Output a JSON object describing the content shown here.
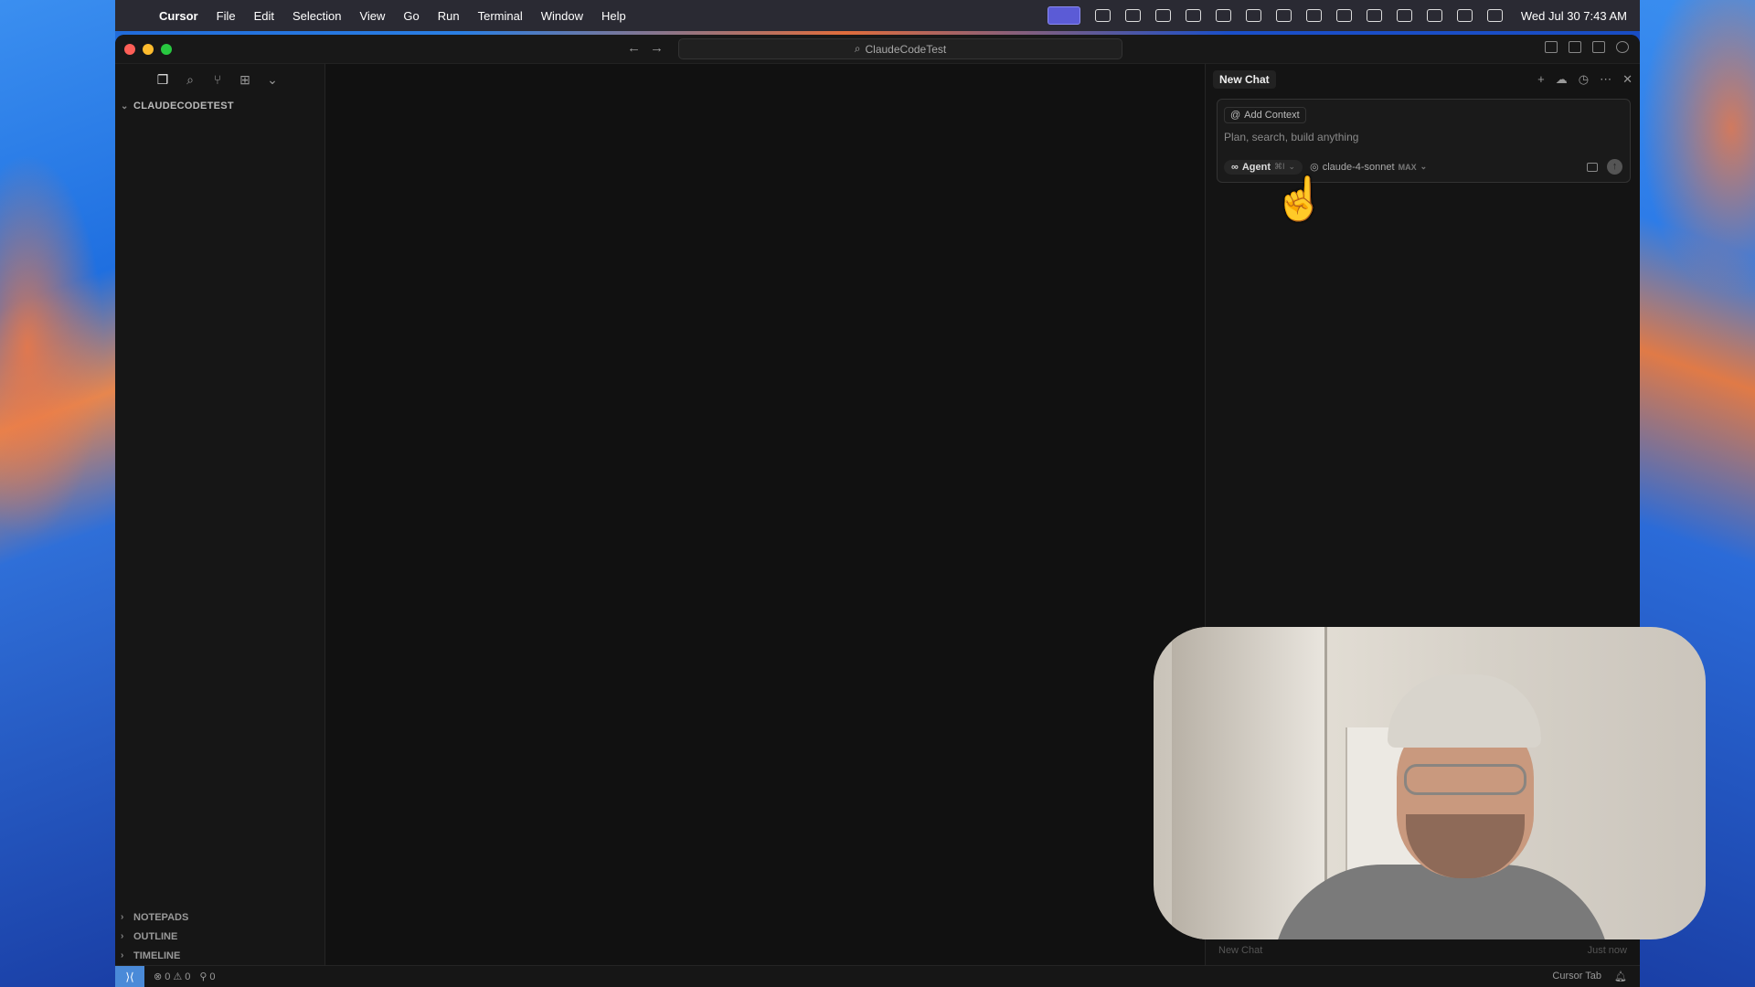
{
  "menubar": {
    "app_name": "Cursor",
    "items": [
      "File",
      "Edit",
      "Selection",
      "View",
      "Go",
      "Run",
      "Terminal",
      "Window",
      "Help"
    ],
    "datetime": "Wed Jul 30  7:43 AM"
  },
  "window": {
    "title": "ClaudeCodeTest"
  },
  "sidebar": {
    "folder": "CLAUDECODETEST",
    "sections": [
      "NOTEPADS",
      "OUTLINE",
      "TIMELINE"
    ]
  },
  "chat": {
    "tab_label": "New Chat",
    "add_context": "Add Context",
    "placeholder": "Plan, search, build anything",
    "agent_label": "Agent",
    "agent_shortcut": "⌘I",
    "model_name": "claude-4-sonnet",
    "model_badge": "MAX",
    "footer_left": "New Chat",
    "footer_right": "Just now"
  },
  "statusbar": {
    "errors": "0",
    "warnings": "0",
    "ports": "0",
    "right_label": "Cursor Tab"
  },
  "colors": {
    "accent": "#4a8ad8",
    "window_bg": "#131313",
    "menubar_bg": "#2a2a33"
  }
}
